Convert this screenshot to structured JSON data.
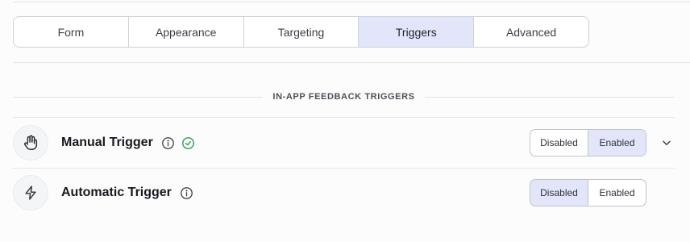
{
  "tabs": [
    {
      "label": "Form"
    },
    {
      "label": "Appearance"
    },
    {
      "label": "Targeting"
    },
    {
      "label": "Triggers"
    },
    {
      "label": "Advanced"
    }
  ],
  "active_tab": "Triggers",
  "section": {
    "title": "IN-APP FEEDBACK TRIGGERS"
  },
  "triggers": [
    {
      "icon": "hand-icon",
      "label": "Manual Trigger",
      "has_info": true,
      "verified": true,
      "options": [
        "Disabled",
        "Enabled"
      ],
      "selected": "Enabled",
      "expandable": true
    },
    {
      "icon": "lightning-icon",
      "label": "Automatic Trigger",
      "has_info": true,
      "verified": false,
      "options": [
        "Disabled",
        "Enabled"
      ],
      "selected": "Disabled",
      "expandable": false
    }
  ],
  "colors": {
    "accent_bg": "#e3e6fb",
    "success": "#2f9e55",
    "border": "#cfd2d7"
  }
}
